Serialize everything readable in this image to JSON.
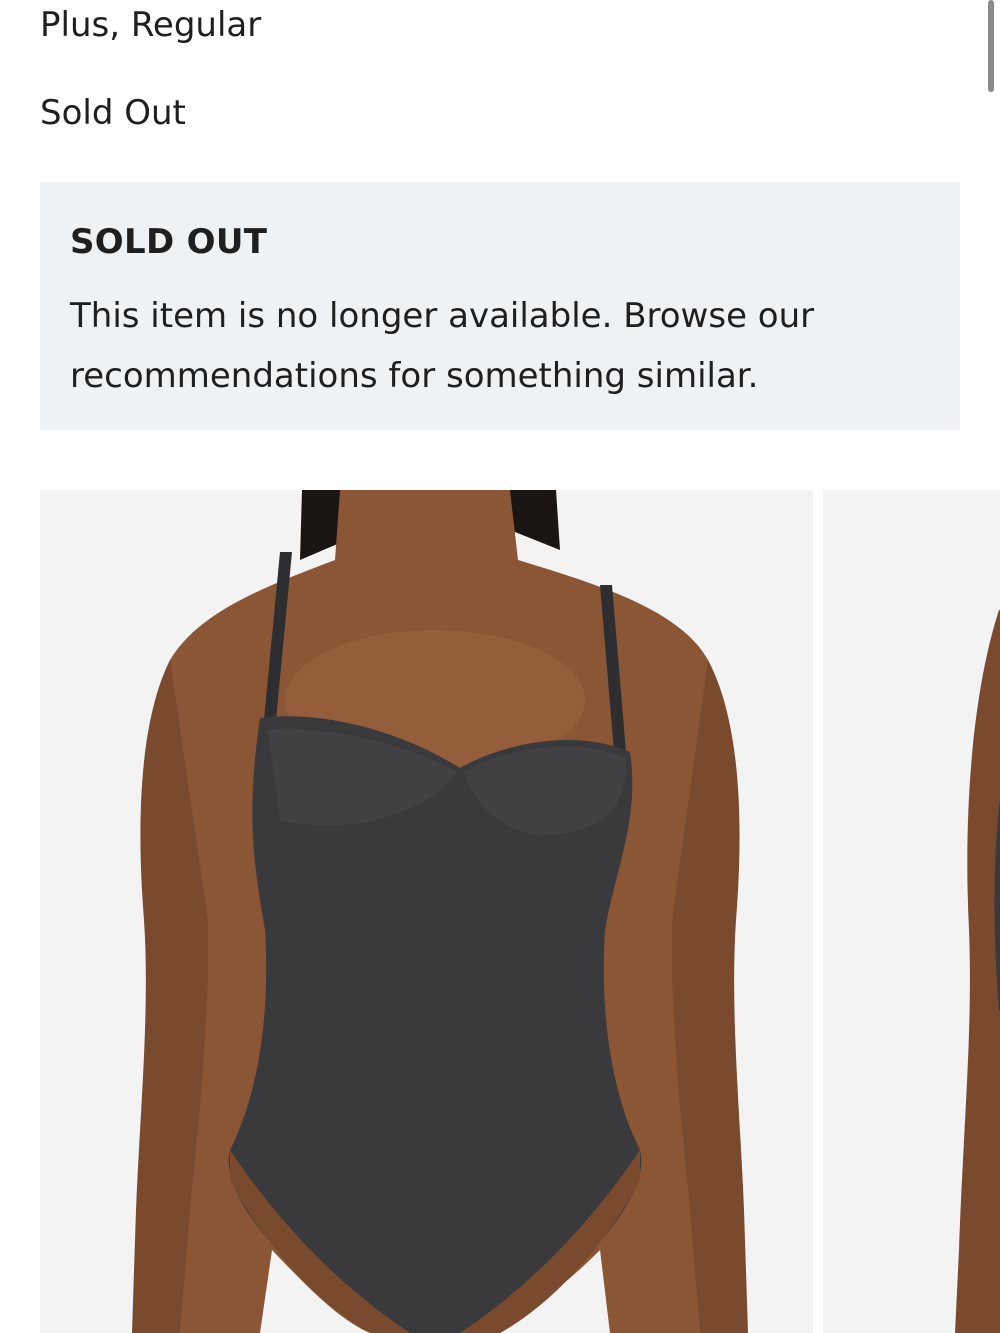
{
  "product": {
    "size_line": "Plus, Regular",
    "availability": "Sold Out"
  },
  "notice": {
    "title": "SOLD OUT",
    "message": "This item is no longer available. Browse our recommendations for something similar."
  },
  "carousel": {
    "images": [
      {
        "alt": "Model wearing black strapless sweetheart bodysuit, front view"
      },
      {
        "alt": "Model wearing black bodysuit, next image partially visible"
      }
    ]
  },
  "colors": {
    "notice_bg": "#eef2f5",
    "image_bg": "#f3f3f3",
    "garment": "#3a3a3c",
    "skin": "#8a5636"
  }
}
